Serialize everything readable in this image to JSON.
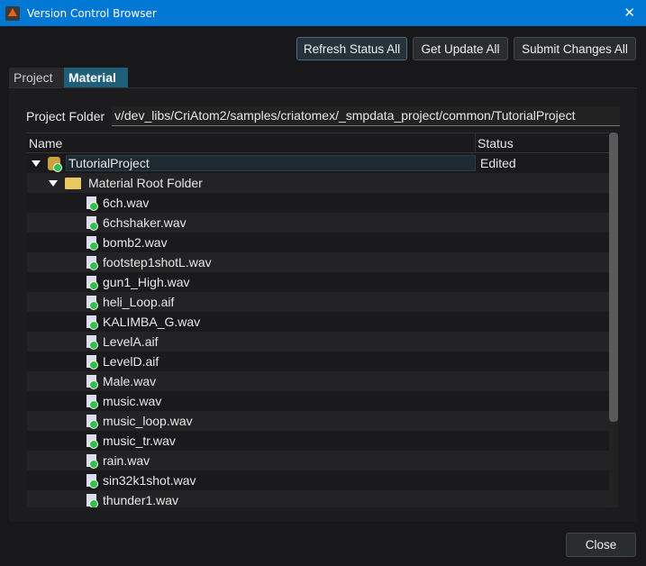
{
  "window": {
    "title": "Version Control Browser",
    "close_glyph": "✕"
  },
  "toolbar": {
    "refresh": "Refresh Status All",
    "update": "Get Update All",
    "submit": "Submit Changes All"
  },
  "tabs": [
    {
      "label": "Project",
      "active": false
    },
    {
      "label": "Material",
      "active": true
    }
  ],
  "project_folder": {
    "label": "Project Folder",
    "value": "v/dev_libs/CriAtom2/samples/criatomex/_smpdata_project/common/TutorialProject"
  },
  "tree": {
    "columns": [
      "Name",
      "Status"
    ],
    "project": {
      "name": "TutorialProject",
      "status": "Edited"
    },
    "folder": {
      "name": "Material Root Folder"
    },
    "files": [
      "6ch.wav",
      "6chshaker.wav",
      "bomb2.wav",
      "footstep1shotL.wav",
      "gun1_High.wav",
      "heli_Loop.aif",
      "KALIMBA_G.wav",
      "LevelA.aif",
      "LevelD.aif",
      "Male.wav",
      "music.wav",
      "music_loop.wav",
      "music_tr.wav",
      "rain.wav",
      "sin32k1shot.wav",
      "thunder1.wav"
    ]
  },
  "footer": {
    "close": "Close"
  },
  "colors": {
    "titlebar": "#0078d4",
    "active_tab": "#1f5f7a",
    "status_ok": "#2fc24a"
  }
}
